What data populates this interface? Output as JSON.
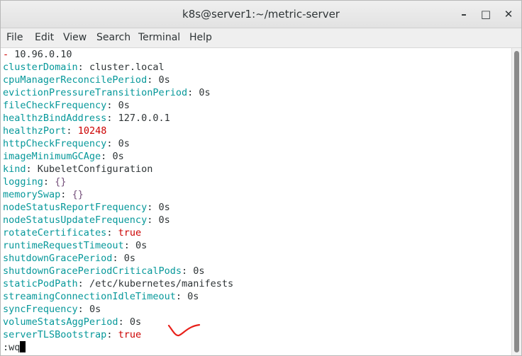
{
  "window": {
    "title": "k8s@server1:~/metric-server",
    "controls": [
      "minimize",
      "maximize",
      "close"
    ],
    "minimize_glyph": "–",
    "maximize_glyph": "□",
    "close_glyph": "✕"
  },
  "menu": [
    "File",
    "Edit",
    "View",
    "Search",
    "Terminal",
    "Help"
  ],
  "terminal": {
    "first_line": {
      "dash": "-",
      "value": "10.96.0.10"
    },
    "lines": [
      {
        "key": "clusterDomain",
        "sep": ":",
        "value": "cluster.local",
        "style": "normal"
      },
      {
        "key": "cpuManagerReconcilePeriod",
        "sep": ":",
        "value": "0s",
        "style": "normal"
      },
      {
        "key": "evictionPressureTransitionPeriod",
        "sep": ":",
        "value": "0s",
        "style": "normal"
      },
      {
        "key": "fileCheckFrequency",
        "sep": ":",
        "value": "0s",
        "style": "normal"
      },
      {
        "key": "healthzBindAddress",
        "sep": ":",
        "value": "127.0.0.1",
        "style": "normal"
      },
      {
        "key": "healthzPort",
        "sep": ":",
        "value": "10248",
        "style": "red"
      },
      {
        "key": "httpCheckFrequency",
        "sep": ":",
        "value": "0s",
        "style": "normal"
      },
      {
        "key": "imageMinimumGCAge",
        "sep": ":",
        "value": "0s",
        "style": "normal"
      },
      {
        "key": "kind",
        "sep": ":",
        "value": "KubeletConfiguration",
        "style": "normal"
      },
      {
        "key": "logging",
        "sep": ":",
        "value": "{}",
        "style": "purple"
      },
      {
        "key": "memorySwap",
        "sep": ":",
        "value": "{}",
        "style": "purple"
      },
      {
        "key": "nodeStatusReportFrequency",
        "sep": ":",
        "value": "0s",
        "style": "normal"
      },
      {
        "key": "nodeStatusUpdateFrequency",
        "sep": ":",
        "value": "0s",
        "style": "normal"
      },
      {
        "key": "rotateCertificates",
        "sep": ":",
        "value": "true",
        "style": "red"
      },
      {
        "key": "runtimeRequestTimeout",
        "sep": ":",
        "value": "0s",
        "style": "normal"
      },
      {
        "key": "shutdownGracePeriod",
        "sep": ":",
        "value": "0s",
        "style": "normal"
      },
      {
        "key": "shutdownGracePeriodCriticalPods",
        "sep": ":",
        "value": "0s",
        "style": "normal"
      },
      {
        "key": "staticPodPath",
        "sep": ":",
        "value": "/etc/kubernetes/manifests",
        "style": "normal"
      },
      {
        "key": "streamingConnectionIdleTimeout",
        "sep": ":",
        "value": "0s",
        "style": "normal"
      },
      {
        "key": "syncFrequency",
        "sep": ":",
        "value": "0s",
        "style": "normal"
      },
      {
        "key": "volumeStatsAggPeriod",
        "sep": ":",
        "value": "0s",
        "style": "normal"
      },
      {
        "key": "serverTLSBootstrap",
        "sep": ":",
        "value": "true",
        "style": "red"
      }
    ],
    "command": ":wq"
  },
  "colors": {
    "key": "#06989a",
    "red_value": "#cc0000",
    "purple_value": "#75507b",
    "text": "#2e3436",
    "annotation": "#e8201a"
  }
}
